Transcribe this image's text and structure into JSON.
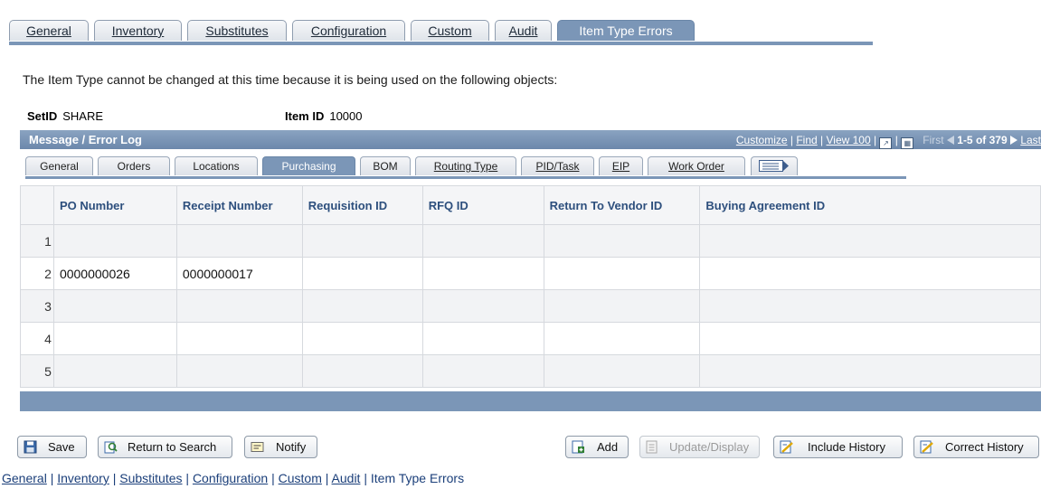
{
  "tabs": [
    "General",
    "Inventory",
    "Substitutes",
    "Configuration",
    "Custom",
    "Audit",
    "Item Type Errors"
  ],
  "notice": "The Item Type cannot be changed at this time because it is being used on the following objects:",
  "setid": {
    "label": "SetID",
    "value": "SHARE"
  },
  "itemid": {
    "label": "Item ID",
    "value": "10000"
  },
  "grid": {
    "title": "Message / Error Log",
    "customize": "Customize",
    "find": "Find",
    "view": "View 100",
    "first": "First",
    "range": "1-5 of 379",
    "last": "Last"
  },
  "subtabs": [
    "General",
    "Orders",
    "Locations",
    "Purchasing",
    "BOM",
    "Routing Type",
    "PID/Task",
    "EIP",
    "Work Order"
  ],
  "columns": [
    "PO Number",
    "Receipt Number",
    "Requisition ID",
    "RFQ ID",
    "Return To Vendor ID",
    "Buying Agreement ID"
  ],
  "rows": [
    {
      "num": "1",
      "po": "",
      "receipt": ""
    },
    {
      "num": "2",
      "po": "0000000026",
      "receipt": "0000000017"
    },
    {
      "num": "3",
      "po": "",
      "receipt": ""
    },
    {
      "num": "4",
      "po": "",
      "receipt": ""
    },
    {
      "num": "5",
      "po": "",
      "receipt": ""
    }
  ],
  "buttons": {
    "save": "Save",
    "return_search": "Return to Search",
    "notify": "Notify",
    "add": "Add",
    "update_display": "Update/Display",
    "include_history": "Include History",
    "correct_history": "Correct History"
  },
  "footer_links": [
    "General",
    "Inventory",
    "Substitutes",
    "Configuration",
    "Custom",
    "Audit",
    "Item Type Errors"
  ],
  "colors": {
    "accent": "#7b96b7",
    "header_text": "#2d4f7d"
  }
}
